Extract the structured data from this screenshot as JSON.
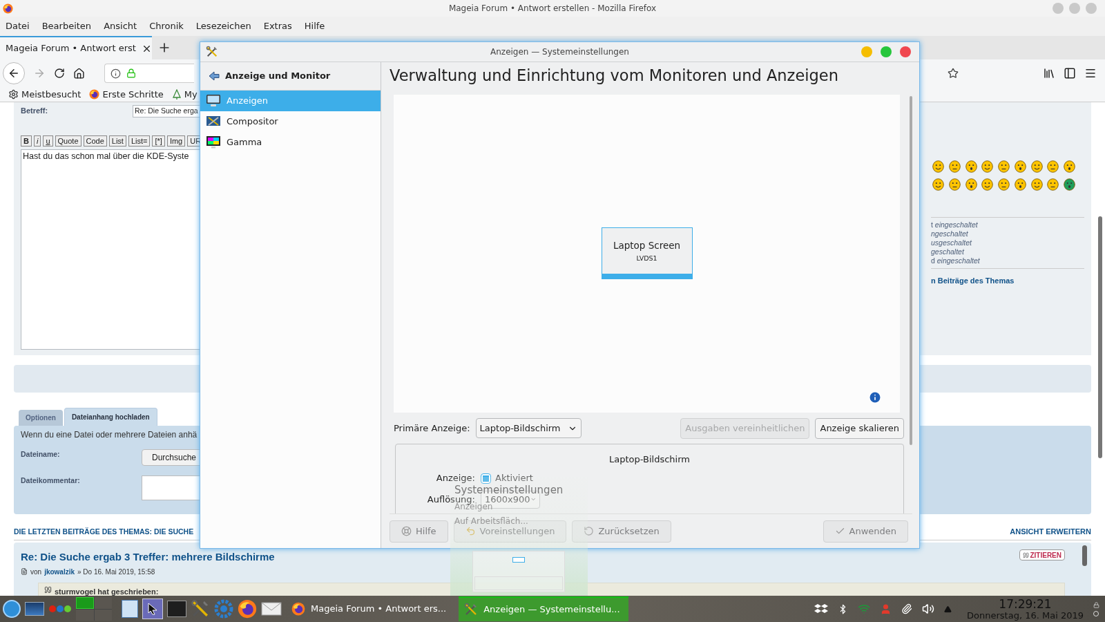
{
  "window": {
    "title": "Mageia Forum • Antwort erstellen - Mozilla Firefox"
  },
  "menu": [
    "Datei",
    "Bearbeiten",
    "Ansicht",
    "Chronik",
    "Lesezeichen",
    "Extras",
    "Hilfe"
  ],
  "tabs": [
    {
      "label": "Mageia Forum • Antwort erst",
      "selected": true
    }
  ],
  "bookmarks": [
    {
      "label": "Meistbesucht",
      "kind": "gear"
    },
    {
      "label": "Erste Schritte",
      "kind": "firefox"
    },
    {
      "label": "My",
      "kind": "tree"
    }
  ],
  "forum": {
    "subject_label": "Betreff:",
    "subject_value": "Re: Die Suche erga",
    "format_buttons": [
      "B",
      "i",
      "u",
      "Quote",
      "Code",
      "List",
      "List=",
      "[*]",
      "Img",
      "UR"
    ],
    "message": "Hast du das schon mal über die KDE-Syste",
    "options": [
      "t *eingeschaltet*",
      "*ngeschaltet*",
      "*usgeschaltet*",
      "*geschaltet*",
      "d *eingeschaltet*"
    ],
    "topic_link": "n Beiträge des Themas",
    "panel_tabs": [
      {
        "label": "Optionen",
        "selected": false
      },
      {
        "label": "Dateianhang hochladen",
        "selected": true
      }
    ],
    "attach_text": "Wenn du eine Datei oder mehrere Dateien anhä",
    "file_label": "Dateiname:",
    "browse_button": "Durchsuche",
    "comment_label": "Dateikommentar:",
    "recent_heading": "DIE LETZTEN BEITRÄGE DES THEMAS: DIE SUCHE",
    "expand_link": "ANSICHT ERWEITERN",
    "post": {
      "title": "Re: Die Suche ergab 3 Treffer: mehrere Bildschirme",
      "by": "von",
      "author": "jkowalzik",
      "date": "» Do 16. Mai 2019, 15:58",
      "quote_button": "ZITIEREN",
      "quote_author": "sturmvogel hat geschrieben:"
    }
  },
  "dialog": {
    "title": "Anzeigen — Systemeinstellungen",
    "sidebar_title": "Anzeige und Monitor",
    "items": [
      {
        "label": "Anzeigen",
        "selected": true,
        "kind": "monitor"
      },
      {
        "label": "Compositor",
        "selected": false,
        "kind": "compositor"
      },
      {
        "label": "Gamma",
        "selected": false,
        "kind": "gamma"
      }
    ],
    "heading": "Verwaltung und Einrichtung vom Monitoren und Anzeigen",
    "output": {
      "name": "Laptop Screen",
      "connector": "LVDS1",
      "selected": true
    },
    "primary_label": "Primäre Anzeige:",
    "primary_value": "Laptop-Bildschirm",
    "buttons": [
      {
        "label": "Ausgaben vereinheitlichen",
        "disabled": true
      },
      {
        "label": "Anzeige skalieren",
        "disabled": false
      }
    ],
    "group": {
      "title": "Laptop-Bildschirm",
      "display_label": "Anzeige:",
      "enabled_label": "Aktiviert",
      "enabled": true,
      "resolution_label": "Auflösung:",
      "resolution": "1600x900"
    },
    "footer": [
      {
        "label": "Hilfe",
        "disabled": true,
        "kind": "help"
      },
      {
        "label": "Voreinstellungen",
        "disabled": true,
        "kind": "defaults"
      },
      {
        "label": "Zurücksetzen",
        "disabled": true,
        "kind": "reset"
      },
      {
        "label": "Anwenden",
        "disabled": true,
        "kind": "apply"
      }
    ]
  },
  "preview": {
    "title": "Systemeinstellungen",
    "lines": [
      "Anzeigen",
      "Auf Arbeitsfläch..."
    ]
  },
  "taskbar": {
    "tasks": [
      {
        "label": "Mageia Forum • Antwort ers...",
        "selected": false,
        "kind": "firefox"
      },
      {
        "label": "Anzeigen  — Systemeinstellu...",
        "selected": true,
        "kind": "tools"
      }
    ],
    "time": "17:29:21",
    "date": "Donnerstag, 16. Mai 2019"
  }
}
